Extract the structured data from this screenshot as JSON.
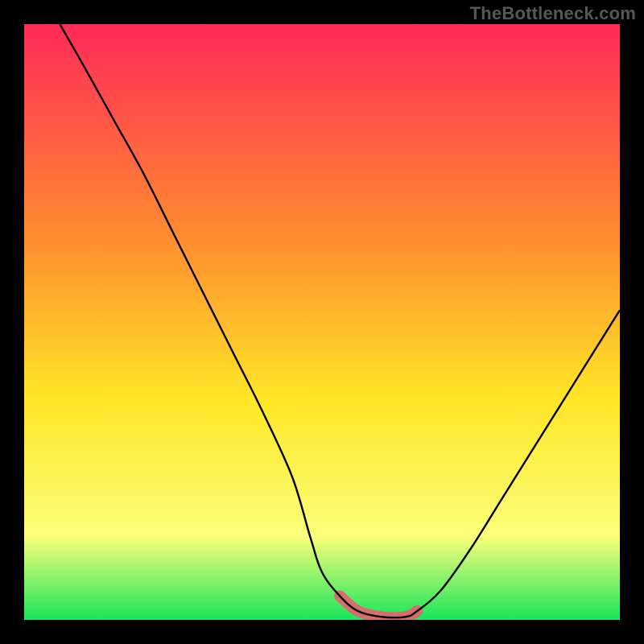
{
  "watermark": "TheBottleneck.com",
  "colors": {
    "frame": "#000000",
    "curve": "#000000",
    "basin": "#d86d6d",
    "gradient_top": "#ff2a58",
    "gradient_mid1": "#ff8a30",
    "gradient_mid2": "#ffe626",
    "gradient_mid3": "#fbff7a",
    "gradient_bottom": "#18e65a"
  },
  "chart_data": {
    "type": "line",
    "title": "",
    "xlabel": "",
    "ylabel": "",
    "xlim": [
      0,
      100
    ],
    "ylim": [
      0,
      100
    ],
    "series": [
      {
        "name": "bottleneck-curve",
        "x": [
          6,
          10,
          15,
          20,
          25,
          30,
          35,
          40,
          45,
          48,
          50,
          53,
          56,
          60,
          64,
          66,
          70,
          75,
          80,
          85,
          90,
          95,
          100
        ],
        "y": [
          100,
          93,
          84,
          75,
          65,
          55,
          45,
          35,
          24,
          14,
          8,
          4,
          1.5,
          0.5,
          0.5,
          1.5,
          5,
          12,
          20,
          28,
          36,
          44,
          52
        ]
      }
    ],
    "annotations": [
      {
        "name": "basin-region",
        "x_range": [
          53,
          66
        ],
        "y": 0.5
      }
    ],
    "grid": false,
    "legend": false
  }
}
